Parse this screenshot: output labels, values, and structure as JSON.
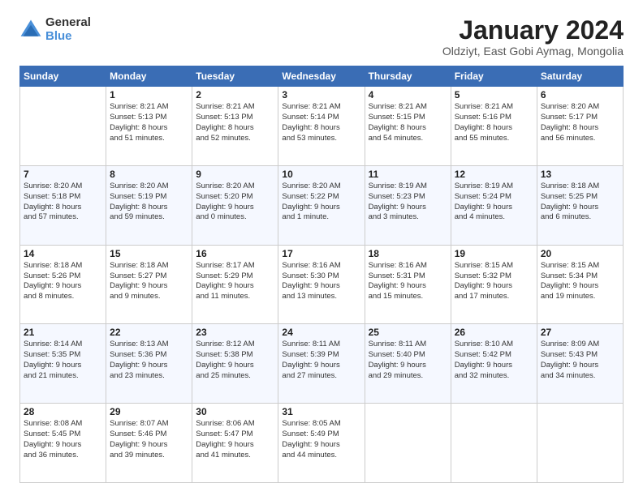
{
  "logo": {
    "general": "General",
    "blue": "Blue"
  },
  "title": "January 2024",
  "subtitle": "Oldziyt, East Gobi Aymag, Mongolia",
  "weekdays": [
    "Sunday",
    "Monday",
    "Tuesday",
    "Wednesday",
    "Thursday",
    "Friday",
    "Saturday"
  ],
  "weeks": [
    [
      {
        "day": "",
        "info": ""
      },
      {
        "day": "1",
        "info": "Sunrise: 8:21 AM\nSunset: 5:13 PM\nDaylight: 8 hours\nand 51 minutes."
      },
      {
        "day": "2",
        "info": "Sunrise: 8:21 AM\nSunset: 5:13 PM\nDaylight: 8 hours\nand 52 minutes."
      },
      {
        "day": "3",
        "info": "Sunrise: 8:21 AM\nSunset: 5:14 PM\nDaylight: 8 hours\nand 53 minutes."
      },
      {
        "day": "4",
        "info": "Sunrise: 8:21 AM\nSunset: 5:15 PM\nDaylight: 8 hours\nand 54 minutes."
      },
      {
        "day": "5",
        "info": "Sunrise: 8:21 AM\nSunset: 5:16 PM\nDaylight: 8 hours\nand 55 minutes."
      },
      {
        "day": "6",
        "info": "Sunrise: 8:20 AM\nSunset: 5:17 PM\nDaylight: 8 hours\nand 56 minutes."
      }
    ],
    [
      {
        "day": "7",
        "info": "Sunrise: 8:20 AM\nSunset: 5:18 PM\nDaylight: 8 hours\nand 57 minutes."
      },
      {
        "day": "8",
        "info": "Sunrise: 8:20 AM\nSunset: 5:19 PM\nDaylight: 8 hours\nand 59 minutes."
      },
      {
        "day": "9",
        "info": "Sunrise: 8:20 AM\nSunset: 5:20 PM\nDaylight: 9 hours\nand 0 minutes."
      },
      {
        "day": "10",
        "info": "Sunrise: 8:20 AM\nSunset: 5:22 PM\nDaylight: 9 hours\nand 1 minute."
      },
      {
        "day": "11",
        "info": "Sunrise: 8:19 AM\nSunset: 5:23 PM\nDaylight: 9 hours\nand 3 minutes."
      },
      {
        "day": "12",
        "info": "Sunrise: 8:19 AM\nSunset: 5:24 PM\nDaylight: 9 hours\nand 4 minutes."
      },
      {
        "day": "13",
        "info": "Sunrise: 8:18 AM\nSunset: 5:25 PM\nDaylight: 9 hours\nand 6 minutes."
      }
    ],
    [
      {
        "day": "14",
        "info": "Sunrise: 8:18 AM\nSunset: 5:26 PM\nDaylight: 9 hours\nand 8 minutes."
      },
      {
        "day": "15",
        "info": "Sunrise: 8:18 AM\nSunset: 5:27 PM\nDaylight: 9 hours\nand 9 minutes."
      },
      {
        "day": "16",
        "info": "Sunrise: 8:17 AM\nSunset: 5:29 PM\nDaylight: 9 hours\nand 11 minutes."
      },
      {
        "day": "17",
        "info": "Sunrise: 8:16 AM\nSunset: 5:30 PM\nDaylight: 9 hours\nand 13 minutes."
      },
      {
        "day": "18",
        "info": "Sunrise: 8:16 AM\nSunset: 5:31 PM\nDaylight: 9 hours\nand 15 minutes."
      },
      {
        "day": "19",
        "info": "Sunrise: 8:15 AM\nSunset: 5:32 PM\nDaylight: 9 hours\nand 17 minutes."
      },
      {
        "day": "20",
        "info": "Sunrise: 8:15 AM\nSunset: 5:34 PM\nDaylight: 9 hours\nand 19 minutes."
      }
    ],
    [
      {
        "day": "21",
        "info": "Sunrise: 8:14 AM\nSunset: 5:35 PM\nDaylight: 9 hours\nand 21 minutes."
      },
      {
        "day": "22",
        "info": "Sunrise: 8:13 AM\nSunset: 5:36 PM\nDaylight: 9 hours\nand 23 minutes."
      },
      {
        "day": "23",
        "info": "Sunrise: 8:12 AM\nSunset: 5:38 PM\nDaylight: 9 hours\nand 25 minutes."
      },
      {
        "day": "24",
        "info": "Sunrise: 8:11 AM\nSunset: 5:39 PM\nDaylight: 9 hours\nand 27 minutes."
      },
      {
        "day": "25",
        "info": "Sunrise: 8:11 AM\nSunset: 5:40 PM\nDaylight: 9 hours\nand 29 minutes."
      },
      {
        "day": "26",
        "info": "Sunrise: 8:10 AM\nSunset: 5:42 PM\nDaylight: 9 hours\nand 32 minutes."
      },
      {
        "day": "27",
        "info": "Sunrise: 8:09 AM\nSunset: 5:43 PM\nDaylight: 9 hours\nand 34 minutes."
      }
    ],
    [
      {
        "day": "28",
        "info": "Sunrise: 8:08 AM\nSunset: 5:45 PM\nDaylight: 9 hours\nand 36 minutes."
      },
      {
        "day": "29",
        "info": "Sunrise: 8:07 AM\nSunset: 5:46 PM\nDaylight: 9 hours\nand 39 minutes."
      },
      {
        "day": "30",
        "info": "Sunrise: 8:06 AM\nSunset: 5:47 PM\nDaylight: 9 hours\nand 41 minutes."
      },
      {
        "day": "31",
        "info": "Sunrise: 8:05 AM\nSunset: 5:49 PM\nDaylight: 9 hours\nand 44 minutes."
      },
      {
        "day": "",
        "info": ""
      },
      {
        "day": "",
        "info": ""
      },
      {
        "day": "",
        "info": ""
      }
    ]
  ]
}
